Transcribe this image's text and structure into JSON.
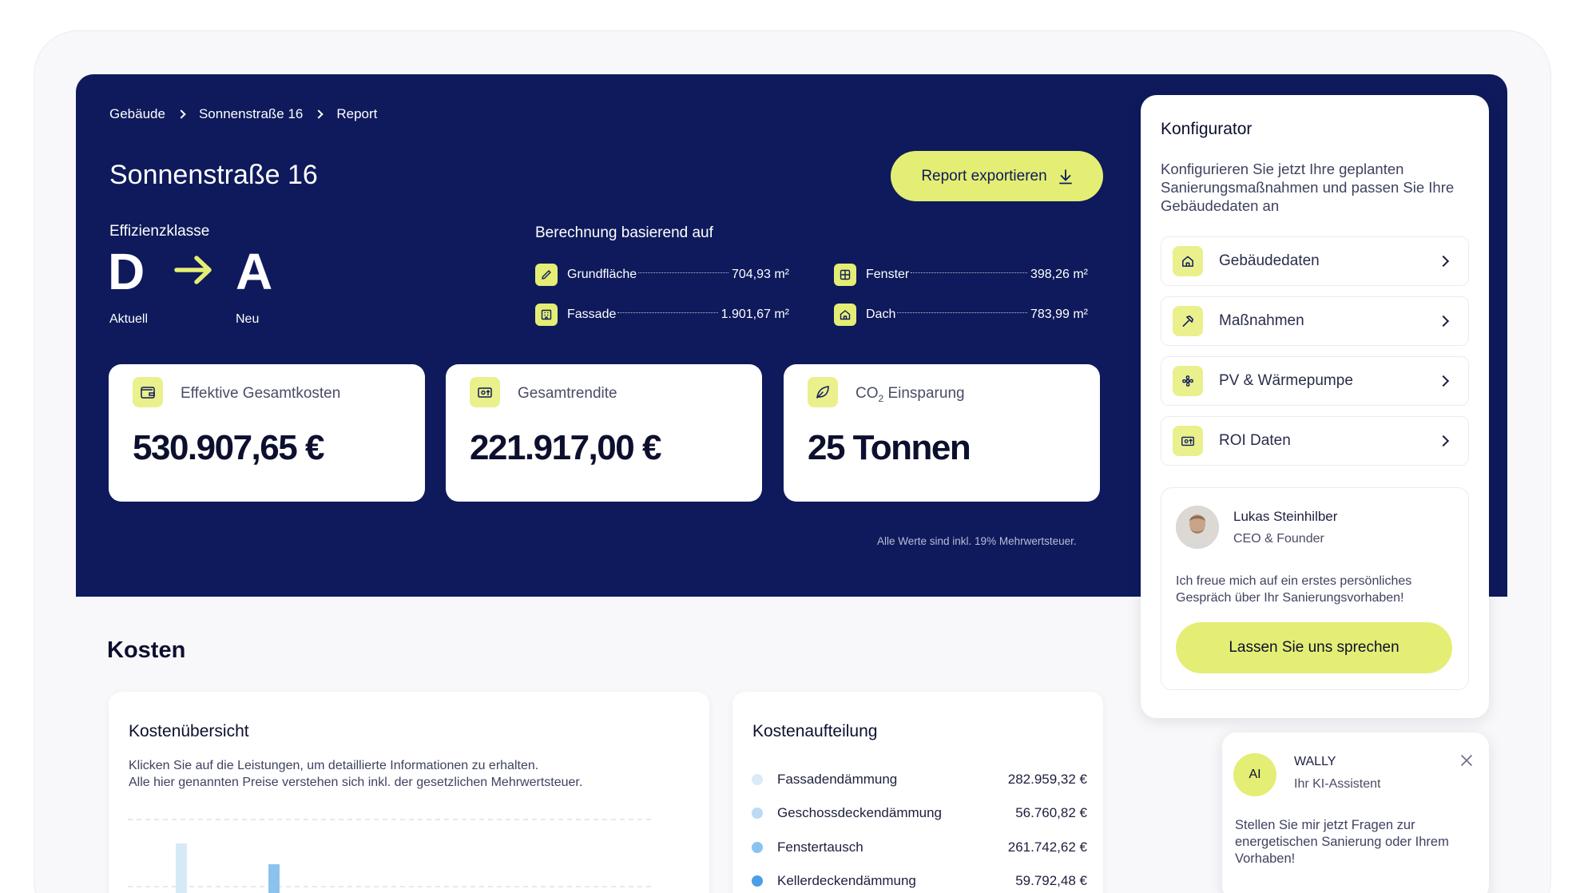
{
  "breadcrumb": [
    "Gebäude",
    "Sonnenstraße 16",
    "Report"
  ],
  "header": {
    "title": "Sonnenstraße 16",
    "export_label": "Report exportieren"
  },
  "efficiency": {
    "label": "Effizienzklasse",
    "current_class": "D",
    "new_class": "A",
    "current_label": "Aktuell",
    "new_label": "Neu"
  },
  "calculation": {
    "label": "Berechnung basierend auf",
    "areas": [
      {
        "name": "Grundfläche",
        "value": "704,93 m²",
        "icon": "pencil-icon"
      },
      {
        "name": "Fenster",
        "value": "398,26 m²",
        "icon": "window-icon"
      },
      {
        "name": "Fassade",
        "value": "1.901,67 m²",
        "icon": "facade-icon"
      },
      {
        "name": "Dach",
        "value": "783,99 m²",
        "icon": "house-icon"
      }
    ]
  },
  "kpis": [
    {
      "label": "Effektive Gesamtkosten",
      "value": "530.907,65 €",
      "icon": "wallet-icon"
    },
    {
      "label": "Gesamtrendite",
      "value": "221.917,00 €",
      "icon": "money-return-icon"
    },
    {
      "label": "CO",
      "label_sub": "2",
      "label_rest": " Einsparung",
      "value": "25 Tonnen",
      "icon": "leaf-icon"
    }
  ],
  "vat_note": "Alle Werte sind inkl. 19% Mehrwertsteuer.",
  "costs": {
    "section_title": "Kosten",
    "overview": {
      "title": "Kostenübersicht",
      "desc_line1": "Klicken Sie auf die Leistungen, um detaillierte Informationen zu erhalten.",
      "desc_line2": "Alle hier genannten Preise verstehen sich inkl. der gesetzlichen Mehrwertsteuer."
    },
    "breakdown": {
      "title": "Kostenaufteilung",
      "items": [
        {
          "name": "Fassadendämmung",
          "value": "282.959,32 €",
          "color": "#dbeaf7"
        },
        {
          "name": "Geschossdeckendämmung",
          "value": "56.760,82 €",
          "color": "#bcdaf3"
        },
        {
          "name": "Fenstertausch",
          "value": "261.742,62 €",
          "color": "#8cc3ee"
        },
        {
          "name": "Kellerdeckendämmung",
          "value": "59.792,48 €",
          "color": "#4a9fe6"
        }
      ]
    }
  },
  "configurator": {
    "title": "Konfigurator",
    "desc": "Konfigurieren Sie jetzt Ihre geplanten Sanierungsmaßnahmen und passen Sie Ihre Gebäudedaten an",
    "items": [
      {
        "label": "Gebäudedaten",
        "icon": "house-icon"
      },
      {
        "label": "Maßnahmen",
        "icon": "hammer-icon"
      },
      {
        "label": "PV & Wärmepumpe",
        "icon": "fan-icon"
      },
      {
        "label": "ROI Daten",
        "icon": "money-return-icon"
      }
    ],
    "contact": {
      "name": "Lukas Steinhilber",
      "role": "CEO & Founder",
      "message": "Ich freue mich auf ein erstes persönliches Gespräch über Ihr Sanierungsvorhaben!",
      "button": "Lassen Sie uns sprechen"
    }
  },
  "assistant": {
    "badge": "AI",
    "name": "WALLY",
    "role": "Ihr KI-Assistent",
    "message": "Stellen Sie mir jetzt Fragen zur energetischen Sanierung oder Ihrem Vorhaben!"
  },
  "colors": {
    "hero": "#0e1a5b",
    "accent": "#e4ee74"
  }
}
